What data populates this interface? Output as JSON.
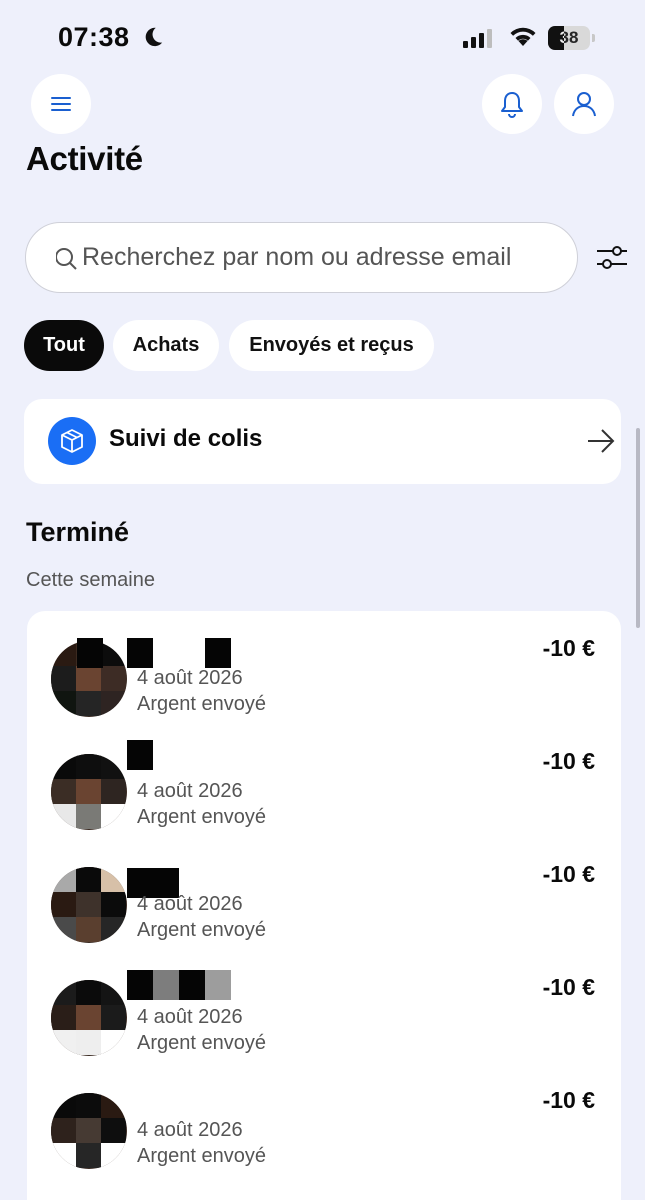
{
  "status_bar": {
    "time": "07:38",
    "battery_level": "38",
    "battery_fraction": 0.38
  },
  "header": {
    "title": "Activité"
  },
  "search": {
    "placeholder": "Recherchez par nom ou adresse email"
  },
  "filters": [
    {
      "label": "Tout",
      "active": true
    },
    {
      "label": "Achats",
      "active": false
    },
    {
      "label": "Envoyés et reçus",
      "active": false
    }
  ],
  "tracking": {
    "label": "Suivi de colis"
  },
  "section": {
    "title": "Terminé",
    "subtitle": "Cette semaine"
  },
  "transactions": [
    {
      "date": "4 août 2026",
      "type": "Argent envoyé",
      "amount": "-10 €"
    },
    {
      "date": "4 août 2026",
      "type": "Argent envoyé",
      "amount": "-10 €"
    },
    {
      "date": "4 août 2026",
      "type": "Argent envoyé",
      "amount": "-10 €"
    },
    {
      "date": "4 août 2026",
      "type": "Argent envoyé",
      "amount": "-10 €"
    },
    {
      "date": "4 août 2026",
      "type": "Argent envoyé",
      "amount": "-10 €"
    }
  ],
  "colors": {
    "background": "#eef0fb",
    "accent": "#1a6ef5",
    "active_chip": "#0a0a0a",
    "icon_blue": "#1a5fd0"
  },
  "icons": {
    "moon": "moon-icon",
    "signal": "cellular-signal-icon",
    "wifi": "wifi-icon",
    "battery": "battery-icon",
    "menu": "hamburger-menu-icon",
    "bell": "bell-icon",
    "profile": "user-profile-icon",
    "search": "search-icon",
    "filter": "filter-sliders-icon",
    "package": "package-box-icon",
    "arrow": "arrow-right-icon"
  }
}
